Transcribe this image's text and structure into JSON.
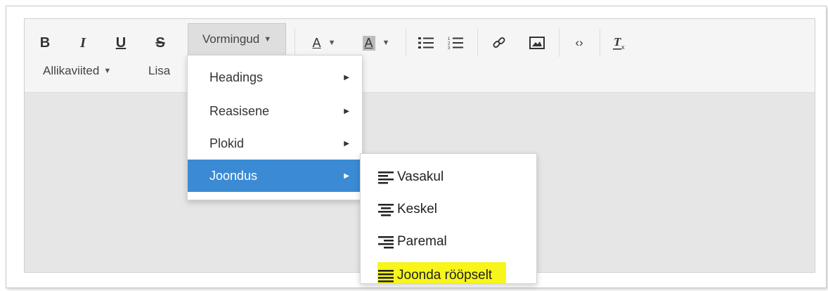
{
  "toolbar": {
    "bold": "B",
    "italic": "I",
    "underline": "U",
    "strike": "S",
    "formats_label": "Vormingud",
    "text_color": "A",
    "bg_color": "A",
    "row2": {
      "references_label": "Allikaviited",
      "insert_label": "Lisa"
    }
  },
  "formats_menu": {
    "items": [
      {
        "label": "Headings",
        "active": false
      },
      {
        "label": "Reasisene",
        "active": false
      },
      {
        "label": "Plokid",
        "active": false
      },
      {
        "label": "Joondus",
        "active": true
      }
    ]
  },
  "align_submenu": {
    "items": [
      {
        "label": "Vasakul",
        "icon": "align-left-icon"
      },
      {
        "label": "Keskel",
        "icon": "align-center-icon"
      },
      {
        "label": "Paremal",
        "icon": "align-right-icon"
      },
      {
        "label": "Joonda rööpselt",
        "icon": "align-justify-icon",
        "highlighted": true
      }
    ]
  },
  "colors": {
    "accent": "#3a8bd4",
    "highlight": "#f7f51a",
    "toolbar_bg": "#f5f5f5",
    "content_bg": "#e6e6e6"
  }
}
